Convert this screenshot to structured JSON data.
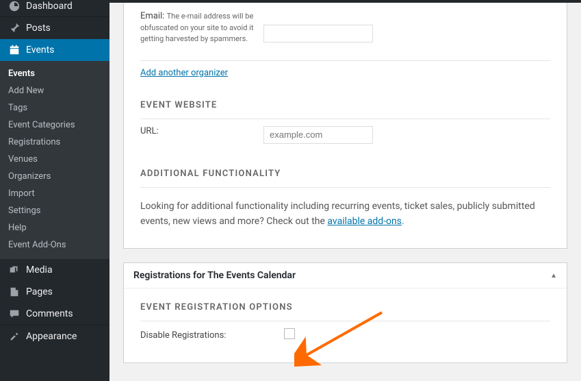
{
  "sidebar": {
    "dashboard": "Dashboard",
    "posts": "Posts",
    "events": "Events",
    "submenu": {
      "events": "Events",
      "addnew": "Add New",
      "tags": "Tags",
      "categories": "Event Categories",
      "registrations": "Registrations",
      "venues": "Venues",
      "organizers": "Organizers",
      "import": "Import",
      "settings": "Settings",
      "help": "Help",
      "addons": "Event Add-Ons"
    },
    "media": "Media",
    "pages": "Pages",
    "comments": "Comments",
    "appearance": "Appearance"
  },
  "organizer": {
    "email_label": "Email:",
    "email_hint": "The e-mail address will be obfuscated on your site to avoid it getting harvested by spammers.",
    "add_link": "Add another organizer"
  },
  "website": {
    "title": "EVENT WEBSITE",
    "url_label": "URL:",
    "url_placeholder": "example.com"
  },
  "additional": {
    "title": "ADDITIONAL FUNCTIONALITY",
    "text_before": "Looking for additional functionality including recurring events, ticket sales, publicly submitted events, new views and more? Check out the ",
    "link_text": "available add-ons",
    "text_after": "."
  },
  "registrations": {
    "panel_title": "Registrations for The Events Calendar",
    "section_title": "EVENT REGISTRATION OPTIONS",
    "disable_label": "Disable Registrations:"
  }
}
